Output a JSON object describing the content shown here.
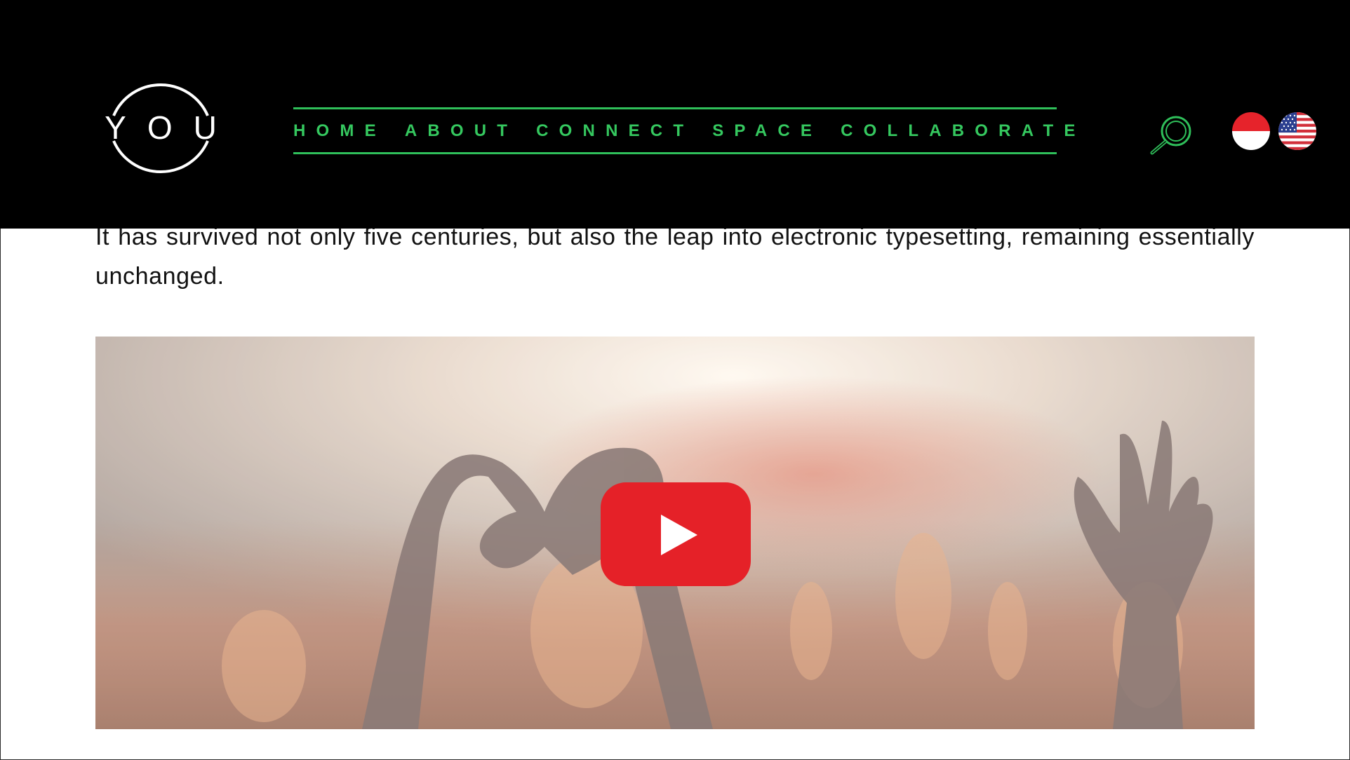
{
  "header": {
    "logo_text": "YOU",
    "nav": [
      {
        "label": "HOME"
      },
      {
        "label": "ABOUT"
      },
      {
        "label": "CONNECT"
      },
      {
        "label": "SPACE"
      },
      {
        "label": "COLLABORATE"
      }
    ],
    "search_icon": "search-icon",
    "flags": [
      "indonesia-flag",
      "usa-flag"
    ]
  },
  "content": {
    "paragraph": "It has survived not only five centuries, but also the leap into electronic typesetting, remaining essentially unchanged."
  },
  "video": {
    "play_icon": "youtube-play-icon"
  },
  "colors": {
    "header_bg": "#000000",
    "accent_green": "#2fbf5a",
    "youtube_red": "#e52128"
  }
}
